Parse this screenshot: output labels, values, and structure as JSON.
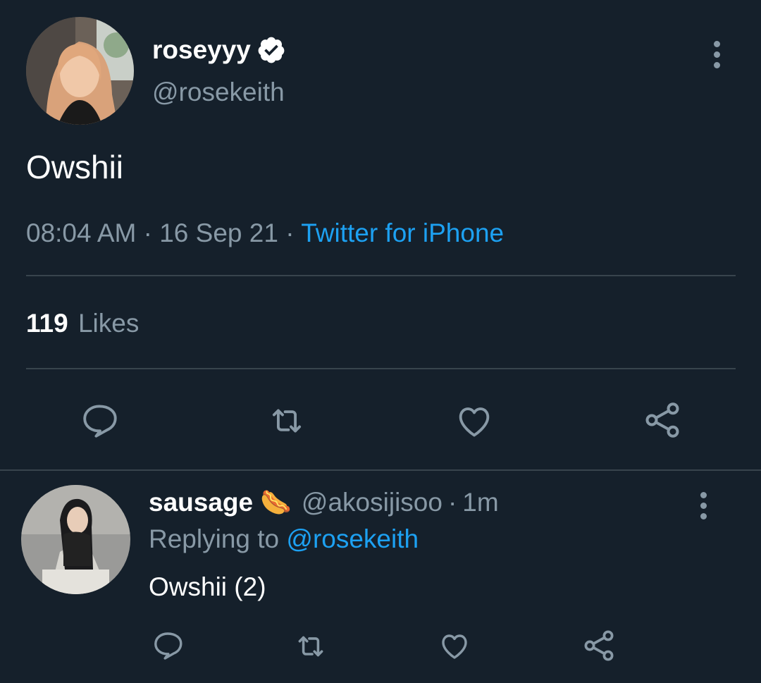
{
  "tweet": {
    "display_name": "roseyyy",
    "handle": "@rosekeith",
    "verified": true,
    "text": "Owshii",
    "time": "08:04 AM",
    "separator": "·",
    "date": "16 Sep 21",
    "source": "Twitter for iPhone",
    "likes_count": "119",
    "likes_label": "Likes"
  },
  "reply": {
    "display_name": "sausage",
    "emoji": "🌭",
    "handle": "@akosijisoo",
    "separator": "·",
    "time": "1m",
    "replying_label": "Replying to",
    "replying_handle": "@rosekeith",
    "text": "Owshii (2)"
  },
  "icons": [
    "reply-icon",
    "retweet-icon",
    "like-icon",
    "share-icon",
    "more-icon",
    "verified-badge-icon"
  ],
  "colors": {
    "background": "#15202b",
    "muted": "#8899a6",
    "link": "#1da1f2",
    "divider": "#38444d",
    "text": "#ffffff"
  }
}
